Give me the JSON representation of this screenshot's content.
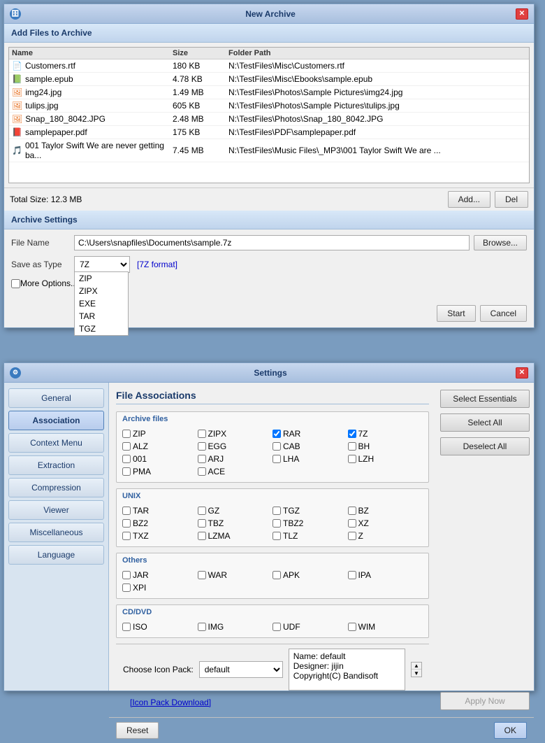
{
  "archive_window": {
    "title": "New Archive",
    "section_header": "Add Files to Archive",
    "columns": [
      "Name",
      "Size",
      "Folder Path"
    ],
    "files": [
      {
        "icon": "doc",
        "name": "Customers.rtf",
        "size": "180 KB",
        "path": "N:\\TestFiles\\Misc\\Customers.rtf"
      },
      {
        "icon": "epub",
        "name": "sample.epub",
        "size": "4.78 KB",
        "path": "N:\\TestFiles\\Misc\\Ebooks\\sample.epub"
      },
      {
        "icon": "img",
        "name": "img24.jpg",
        "size": "1.49 MB",
        "path": "N:\\TestFiles\\Photos\\Sample Pictures\\img24.jpg"
      },
      {
        "icon": "img",
        "name": "tulips.jpg",
        "size": "605 KB",
        "path": "N:\\TestFiles\\Photos\\Sample Pictures\\tulips.jpg"
      },
      {
        "icon": "img",
        "name": "Snap_180_8042.JPG",
        "size": "2.48 MB",
        "path": "N:\\TestFiles\\Photos\\Snap_180_8042.JPG"
      },
      {
        "icon": "pdf",
        "name": "samplepaper.pdf",
        "size": "175 KB",
        "path": "N:\\TestFiles\\PDF\\samplepaper.pdf"
      },
      {
        "icon": "music",
        "name": "001 Taylor Swift We are never getting ba...",
        "size": "7.45 MB",
        "path": "N:\\TestFiles\\Music Files\\_MP3\\001 Taylor Swift We are ..."
      }
    ],
    "total_size_label": "Total Size: 12.3 MB",
    "add_button": "Add...",
    "del_button": "Del",
    "settings_header": "Archive Settings",
    "file_name_label": "File Name",
    "file_name_value": "C:\\Users\\snapfiles\\Documents\\sample.7z",
    "browse_button": "Browse...",
    "save_type_label": "Save as Type",
    "save_type_value": "7Z",
    "format_hint": "[7Z format]",
    "dropdown_items": [
      "ZIP",
      "ZIPX",
      "EXE",
      "TAR",
      "TGZ"
    ],
    "more_options_label": "More Options...",
    "start_button": "Start",
    "cancel_button": "Cancel"
  },
  "settings_window": {
    "title": "Settings",
    "sidebar_items": [
      {
        "id": "general",
        "label": "General"
      },
      {
        "id": "association",
        "label": "Association"
      },
      {
        "id": "context_menu",
        "label": "Context Menu"
      },
      {
        "id": "extraction",
        "label": "Extraction"
      },
      {
        "id": "compression",
        "label": "Compression"
      },
      {
        "id": "viewer",
        "label": "Viewer"
      },
      {
        "id": "miscellaneous",
        "label": "Miscellaneous"
      },
      {
        "id": "language",
        "label": "Language"
      }
    ],
    "active_tab": "association",
    "content_title": "File Associations",
    "archive_group": {
      "label": "Archive files",
      "items": [
        {
          "label": "ZIP",
          "checked": false
        },
        {
          "label": "ZIPX",
          "checked": false
        },
        {
          "label": "RAR",
          "checked": true
        },
        {
          "label": "7Z",
          "checked": true
        },
        {
          "label": "ALZ",
          "checked": false
        },
        {
          "label": "EGG",
          "checked": false
        },
        {
          "label": "CAB",
          "checked": false
        },
        {
          "label": "BH",
          "checked": false
        },
        {
          "label": "001",
          "checked": false
        },
        {
          "label": "ARJ",
          "checked": false
        },
        {
          "label": "LHA",
          "checked": false
        },
        {
          "label": "LZH",
          "checked": false
        },
        {
          "label": "PMA",
          "checked": false
        },
        {
          "label": "ACE",
          "checked": false
        }
      ]
    },
    "unix_group": {
      "label": "UNIX",
      "items": [
        {
          "label": "TAR",
          "checked": false
        },
        {
          "label": "GZ",
          "checked": false
        },
        {
          "label": "TGZ",
          "checked": false
        },
        {
          "label": "BZ",
          "checked": false
        },
        {
          "label": "BZ2",
          "checked": false
        },
        {
          "label": "TBZ",
          "checked": false
        },
        {
          "label": "TBZ2",
          "checked": false
        },
        {
          "label": "XZ",
          "checked": false
        },
        {
          "label": "TXZ",
          "checked": false
        },
        {
          "label": "LZMA",
          "checked": false
        },
        {
          "label": "TLZ",
          "checked": false
        },
        {
          "label": "Z",
          "checked": false
        }
      ]
    },
    "others_group": {
      "label": "Others",
      "items": [
        {
          "label": "JAR",
          "checked": false
        },
        {
          "label": "WAR",
          "checked": false
        },
        {
          "label": "APK",
          "checked": false
        },
        {
          "label": "IPA",
          "checked": false
        },
        {
          "label": "XPI",
          "checked": false
        }
      ]
    },
    "cddvd_group": {
      "label": "CD/DVD",
      "items": [
        {
          "label": "ISO",
          "checked": false
        },
        {
          "label": "IMG",
          "checked": false
        },
        {
          "label": "UDF",
          "checked": false
        },
        {
          "label": "WIM",
          "checked": false
        }
      ]
    },
    "select_essentials_btn": "Select Essentials",
    "select_all_btn": "Select All",
    "deselect_all_btn": "Deselect All",
    "apply_now_btn": "Apply Now",
    "icon_pack_label": "Choose Icon Pack:",
    "icon_pack_value": "default",
    "icon_pack_info": {
      "name": "Name: default",
      "designer": "Designer: jijin",
      "copyright": "Copyright(C) Bandisoft"
    },
    "icon_pack_download": "[Icon Pack Download]",
    "reset_btn": "Reset",
    "ok_btn": "OK"
  }
}
